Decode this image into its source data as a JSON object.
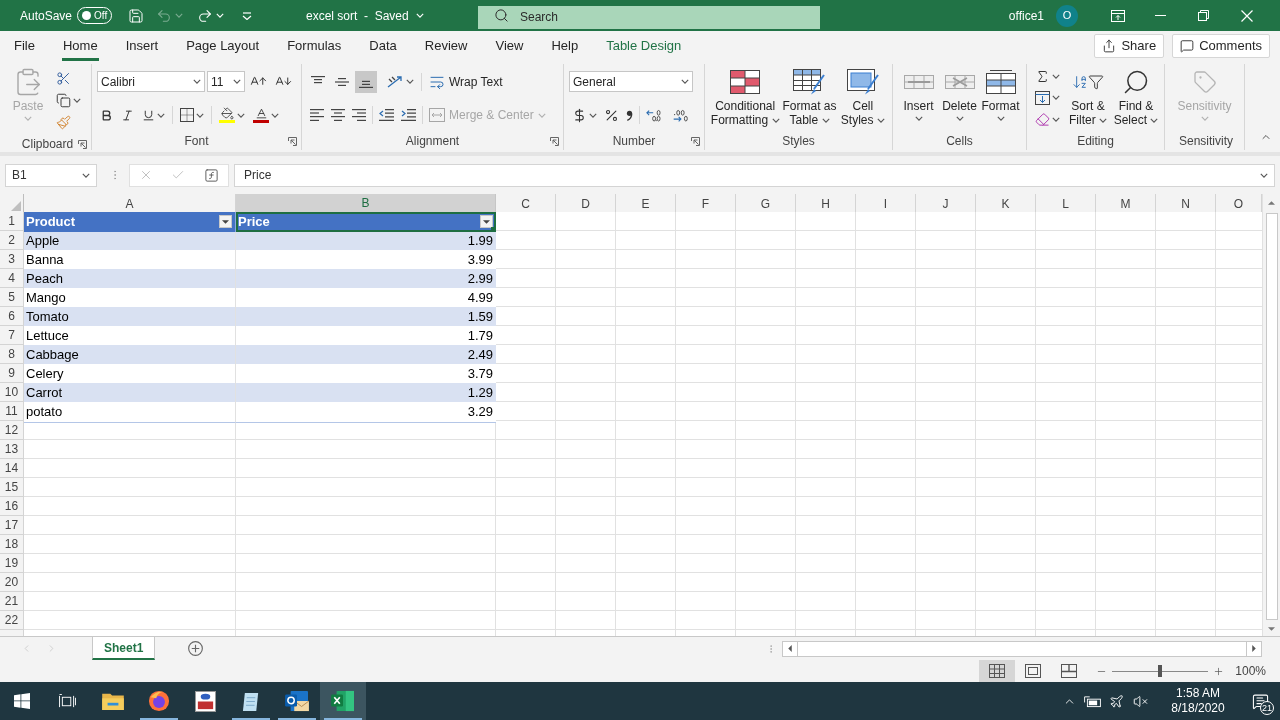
{
  "title_bar": {
    "autosave": {
      "label": "AutoSave",
      "on": false,
      "state": "Off"
    },
    "undo": {
      "disabled": true
    },
    "redo": {
      "disabled": false
    },
    "title": "excel sort  -  Saved",
    "search": {
      "placeholder": "Search"
    },
    "user": {
      "name": "office1",
      "initial": "O"
    }
  },
  "ribbon_tabs": [
    {
      "label": "File",
      "selected": false,
      "kind": "standard"
    },
    {
      "label": "Home",
      "selected": true,
      "kind": "standard"
    },
    {
      "label": "Insert",
      "selected": false,
      "kind": "standard"
    },
    {
      "label": "Page Layout",
      "selected": false,
      "kind": "standard"
    },
    {
      "label": "Formulas",
      "selected": false,
      "kind": "standard"
    },
    {
      "label": "Data",
      "selected": false,
      "kind": "standard"
    },
    {
      "label": "Review",
      "selected": false,
      "kind": "standard"
    },
    {
      "label": "View",
      "selected": false,
      "kind": "standard"
    },
    {
      "label": "Help",
      "selected": false,
      "kind": "standard"
    },
    {
      "label": "Table Design",
      "selected": false,
      "kind": "contextual"
    }
  ],
  "ribbon_actions": [
    "Share",
    "Comments"
  ],
  "ribbon": {
    "clipboard": {
      "label": "Clipboard",
      "launcher": true,
      "paste": {
        "label": "Paste",
        "disabled": true
      }
    },
    "font": {
      "label": "Font",
      "launcher": true,
      "font_name": "Calibri",
      "font_size": "11"
    },
    "alignment": {
      "label": "Alignment",
      "launcher": true,
      "vertical_align": [
        {
          "selected": false
        },
        {
          "selected": false
        },
        {
          "selected": true
        }
      ],
      "wrap_text": "Wrap Text",
      "merge": {
        "label": "Merge & Center",
        "disabled": true
      }
    },
    "number": {
      "label": "Number",
      "launcher": true,
      "format": "General"
    },
    "styles": {
      "label": "Styles",
      "launcher": false,
      "buttons": [
        "Conditional Formatting",
        "Format as Table",
        "Cell Styles"
      ]
    },
    "cells": {
      "label": "Cells",
      "launcher": false,
      "buttons": [
        "Insert",
        "Delete",
        "Format"
      ]
    },
    "editing": {
      "label": "Editing",
      "launcher": false,
      "buttons": [
        "Sort & Filter",
        "Find & Select"
      ]
    },
    "sensitivity": {
      "label": "Sensitivity",
      "launcher": false,
      "button": {
        "label": "Sensitivity",
        "disabled": true
      }
    }
  },
  "formula_bar": {
    "name_box": "B1",
    "formula": "Price"
  },
  "sheet": {
    "columns": [
      {
        "label": "A",
        "selected": false
      },
      {
        "label": "B",
        "selected": true
      },
      {
        "label": "C",
        "selected": false
      },
      {
        "label": "D",
        "selected": false
      },
      {
        "label": "E",
        "selected": false
      },
      {
        "label": "F",
        "selected": false
      },
      {
        "label": "G",
        "selected": false
      },
      {
        "label": "H",
        "selected": false
      },
      {
        "label": "I",
        "selected": false
      },
      {
        "label": "J",
        "selected": false
      },
      {
        "label": "K",
        "selected": false
      },
      {
        "label": "L",
        "selected": false
      },
      {
        "label": "M",
        "selected": false
      },
      {
        "label": "N",
        "selected": false
      },
      {
        "label": "O",
        "selected": false
      }
    ],
    "row_headers": [
      "1",
      "2",
      "3",
      "4",
      "5",
      "6",
      "7",
      "8",
      "9",
      "10",
      "11",
      "12",
      "13",
      "14",
      "15",
      "16",
      "17",
      "18",
      "19",
      "20",
      "21",
      "22"
    ],
    "table": {
      "header": [
        {
          "label": "Product",
          "selected": false
        },
        {
          "label": "Price",
          "selected": true
        }
      ],
      "rows": [
        [
          "Apple",
          "1.99"
        ],
        [
          "Banna",
          "3.99"
        ],
        [
          "Peach",
          "2.99"
        ],
        [
          "Mango",
          "4.99"
        ],
        [
          "Tomato",
          "1.59"
        ],
        [
          "Lettuce",
          "1.79"
        ],
        [
          "Cabbage",
          "2.49"
        ],
        [
          "Celery",
          "3.79"
        ],
        [
          "Carrot",
          "1.29"
        ],
        [
          "potato",
          "3.29"
        ]
      ]
    }
  },
  "sheet_tabs": [
    {
      "label": "Sheet1",
      "selected": true
    }
  ],
  "status_bar": {
    "views": [
      {
        "selected": true
      },
      {
        "selected": false
      },
      {
        "selected": false
      }
    ],
    "zoom": {
      "level": 0.5,
      "label": "100%"
    }
  },
  "taskbar": {
    "apps": [
      {
        "running": false,
        "selected": false
      },
      {
        "running": true,
        "selected": false
      },
      {
        "running": false,
        "selected": false
      },
      {
        "running": true,
        "selected": false
      },
      {
        "running": true,
        "selected": false
      },
      {
        "running": true,
        "selected": true
      }
    ],
    "clock": {
      "time": "1:58 AM",
      "date": "8/18/2020"
    },
    "notifications": "21"
  }
}
